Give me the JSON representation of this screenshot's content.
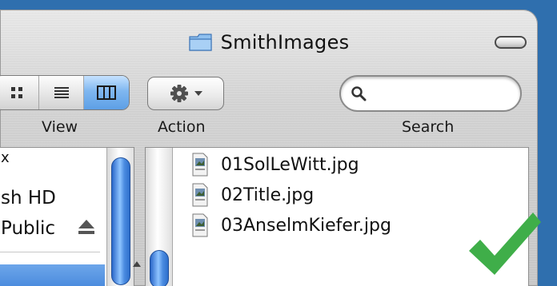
{
  "window": {
    "title": "SmithImages"
  },
  "toolbar": {
    "view_label": "View",
    "action_label": "Action",
    "search_label": "Search",
    "search_value": ""
  },
  "sidebar": {
    "items": [
      {
        "label": "x"
      },
      {
        "label": "sh HD"
      },
      {
        "label": "Public"
      }
    ]
  },
  "files": [
    {
      "name": "01SolLeWitt.jpg"
    },
    {
      "name": "02Title.jpg"
    },
    {
      "name": "03AnselmKiefer.jpg"
    }
  ],
  "colors": {
    "accent_blue": "#5d9fe6",
    "check_green": "#3fae49",
    "desktop": "#2f6fae"
  }
}
